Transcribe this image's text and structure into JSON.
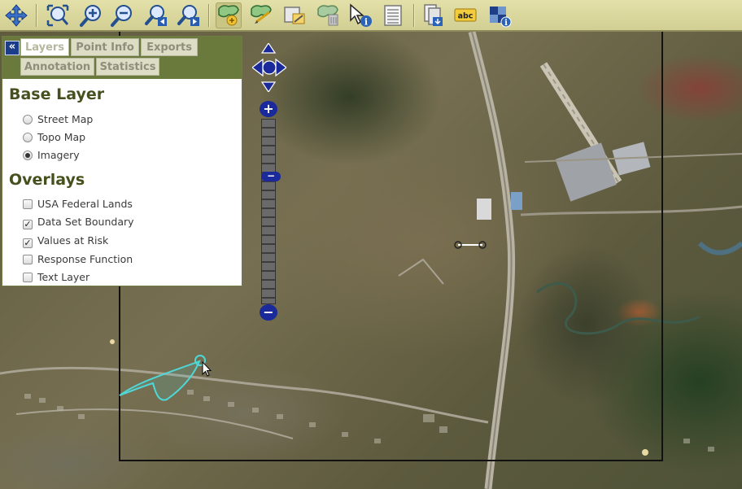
{
  "toolbar": {
    "tools": [
      {
        "icon": "pan-icon",
        "active": false
      },
      {
        "icon": "zoom-extent-icon",
        "active": false
      },
      {
        "icon": "zoom-in-icon",
        "active": false
      },
      {
        "icon": "zoom-out-icon",
        "active": false
      },
      {
        "icon": "zoom-previous-icon",
        "active": false
      },
      {
        "icon": "zoom-next-icon",
        "active": false
      },
      {
        "icon": "draw-polygon-icon",
        "active": true
      },
      {
        "icon": "draw-shape-icon",
        "active": false
      },
      {
        "icon": "edit-shape-icon",
        "active": false
      },
      {
        "icon": "delete-shape-icon",
        "active": false
      },
      {
        "icon": "identify-icon",
        "active": false
      },
      {
        "icon": "attribute-table-icon",
        "active": false
      },
      {
        "icon": "export-map-icon",
        "active": false
      },
      {
        "icon": "label-icon",
        "active": false
      },
      {
        "icon": "overview-icon",
        "active": false
      }
    ],
    "label_tool_text": "abc"
  },
  "panel": {
    "collapse_icon": "«",
    "tabs": [
      "Layers",
      "Point Info",
      "Exports",
      "Annotation",
      "Statistics"
    ],
    "selected_tab": "Layers",
    "base_layer_heading": "Base Layer",
    "base_layers": [
      {
        "label": "Street Map",
        "selected": false
      },
      {
        "label": "Topo Map",
        "selected": false
      },
      {
        "label": "Imagery",
        "selected": true
      }
    ],
    "overlays_heading": "Overlays",
    "overlays": [
      {
        "label": "USA Federal Lands",
        "checked": false
      },
      {
        "label": "Data Set Boundary",
        "checked": true
      },
      {
        "label": "Values at Risk",
        "checked": true
      },
      {
        "label": "Response Function",
        "checked": false
      },
      {
        "label": "Text Layer",
        "checked": false
      }
    ]
  },
  "map_controls": {
    "zoom_in_symbol": "+",
    "zoom_out_symbol": "−",
    "zoom_thumb_symbol": "−"
  },
  "colors": {
    "toolbar_bg": "#d9d695",
    "panel_header": "#6a7a3c",
    "heading_text": "#46501f",
    "control_blue": "#1a2a9a",
    "drawn_polygon": "#4fd7d7"
  }
}
